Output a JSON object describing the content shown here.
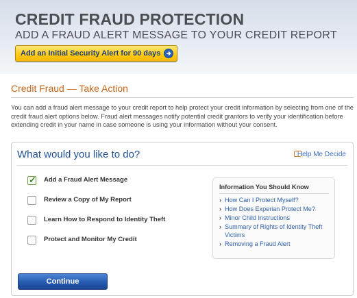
{
  "header": {
    "title": "CREDIT FRAUD PROTECTION",
    "subtitle": "ADD A FRAUD ALERT MESSAGE TO YOUR CREDIT REPORT",
    "alert_button_label": "Add an Initial Security Alert for 90 days"
  },
  "section": {
    "title": "Credit Fraud — Take Action",
    "intro": "You can add a fraud alert message to your credit report to help protect your credit information by selecting from one of the credit fraud alert options below. Fraud alert messages notify potential credit grantors to verify your identification before extending credit in your name in case someone is using your information without your consent."
  },
  "panel": {
    "title": "What would you like to do?",
    "help_link": "Help Me Decide",
    "options": [
      {
        "label": "Add a Fraud Alert Message",
        "checked": true
      },
      {
        "label": "Review a Copy of My Report",
        "checked": false
      },
      {
        "label": "Learn How to Respond to Identity Theft",
        "checked": false
      },
      {
        "label": "Protect and Monitor My Credit",
        "checked": false
      }
    ],
    "info": {
      "title": "Information You Should Know",
      "links": [
        "How Can I Protect Myself?",
        "How Does Experian Protect Me?",
        "Minor Child Instructions",
        "Summary of Rights of Identity Theft Victims",
        "Removing a Fraud Alert"
      ]
    },
    "continue_label": "Continue"
  },
  "colors": {
    "accent_orange": "#c4661a",
    "link_blue": "#2c5ea8",
    "title_blue": "#1f4f93",
    "button_yellow": "#ffcc1a",
    "button_blue": "#2a5eb3"
  }
}
